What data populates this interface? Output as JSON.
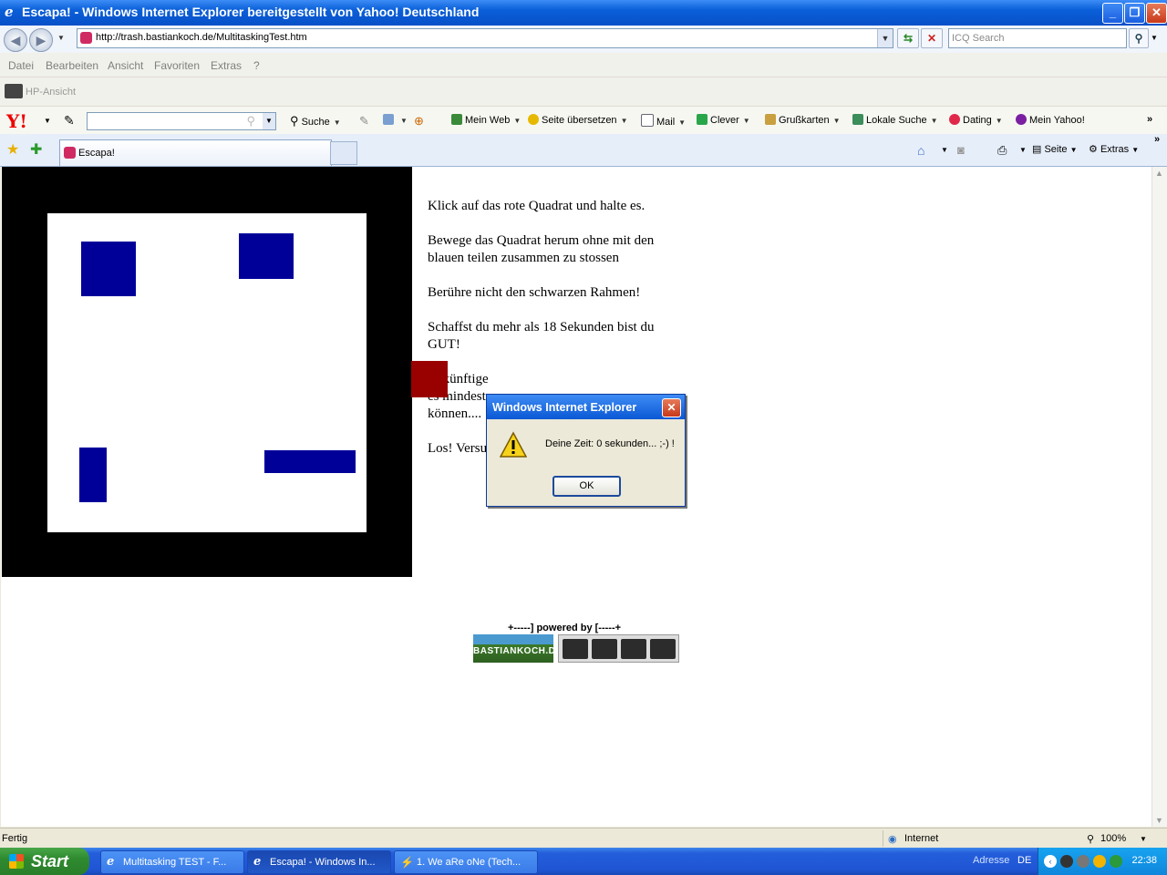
{
  "window": {
    "title": "Escapa! - Windows Internet Explorer bereitgestellt von Yahoo! Deutschland",
    "minimize_icon": "minimize-icon",
    "maximize_icon": "maximize-icon",
    "close_icon": "close-icon"
  },
  "address_bar": {
    "url": "http://trash.bastiankoch.de/MultitaskingTest.htm",
    "search_placeholder": "ICQ Search"
  },
  "menu": [
    "Datei",
    "Bearbeiten",
    "Ansicht",
    "Favoriten",
    "Extras",
    "?"
  ],
  "hp_toolbar": {
    "label": "HP-Ansicht"
  },
  "yahoo_toolbar": {
    "logo": "Y!",
    "search_label": "Suche",
    "items": [
      "Mein Web",
      "Seite übersetzen",
      "Mail",
      "Clever",
      "Grußkarten",
      "Lokale Suche",
      "Dating",
      "Mein Yahoo!"
    ]
  },
  "tabs": {
    "active_tab": "Escapa!",
    "seite_label": "Seite",
    "extras_label": "Extras"
  },
  "page": {
    "instructions": [
      "Klick auf das rote Quadrat und halte es.",
      "Bewege das Quadrat herum ohne mit den blauen teilen zusammen zu stossen",
      "Berühre nicht den schwarzen Rahmen!",
      "Schaffst du mehr als 18 Sekunden bist du GUT!",
      "Zukünftige",
      "es mindest",
      "können....",
      "Los! Versu"
    ],
    "powered_by": "+-----] powered by [-----+",
    "logo_text": "BASTIANKOCH.DE"
  },
  "dialog": {
    "title": "Windows Internet Explorer",
    "message": "Deine Zeit: 0 sekunden... ;-) !",
    "ok_label": "OK"
  },
  "status_bar": {
    "status": "Fertig",
    "zone": "Internet",
    "zoom": "100%"
  },
  "taskbar": {
    "start_label": "Start",
    "tasks": [
      "Multitasking TEST - F...",
      "Escapa! - Windows In...",
      "1. We aRe oNe (Tech..."
    ],
    "adresse_label": "Adresse",
    "language": "DE",
    "clock": "22:38"
  },
  "colors": {
    "red_square": "#990000",
    "blue_blocks": "#000099",
    "frame": "#000000"
  }
}
